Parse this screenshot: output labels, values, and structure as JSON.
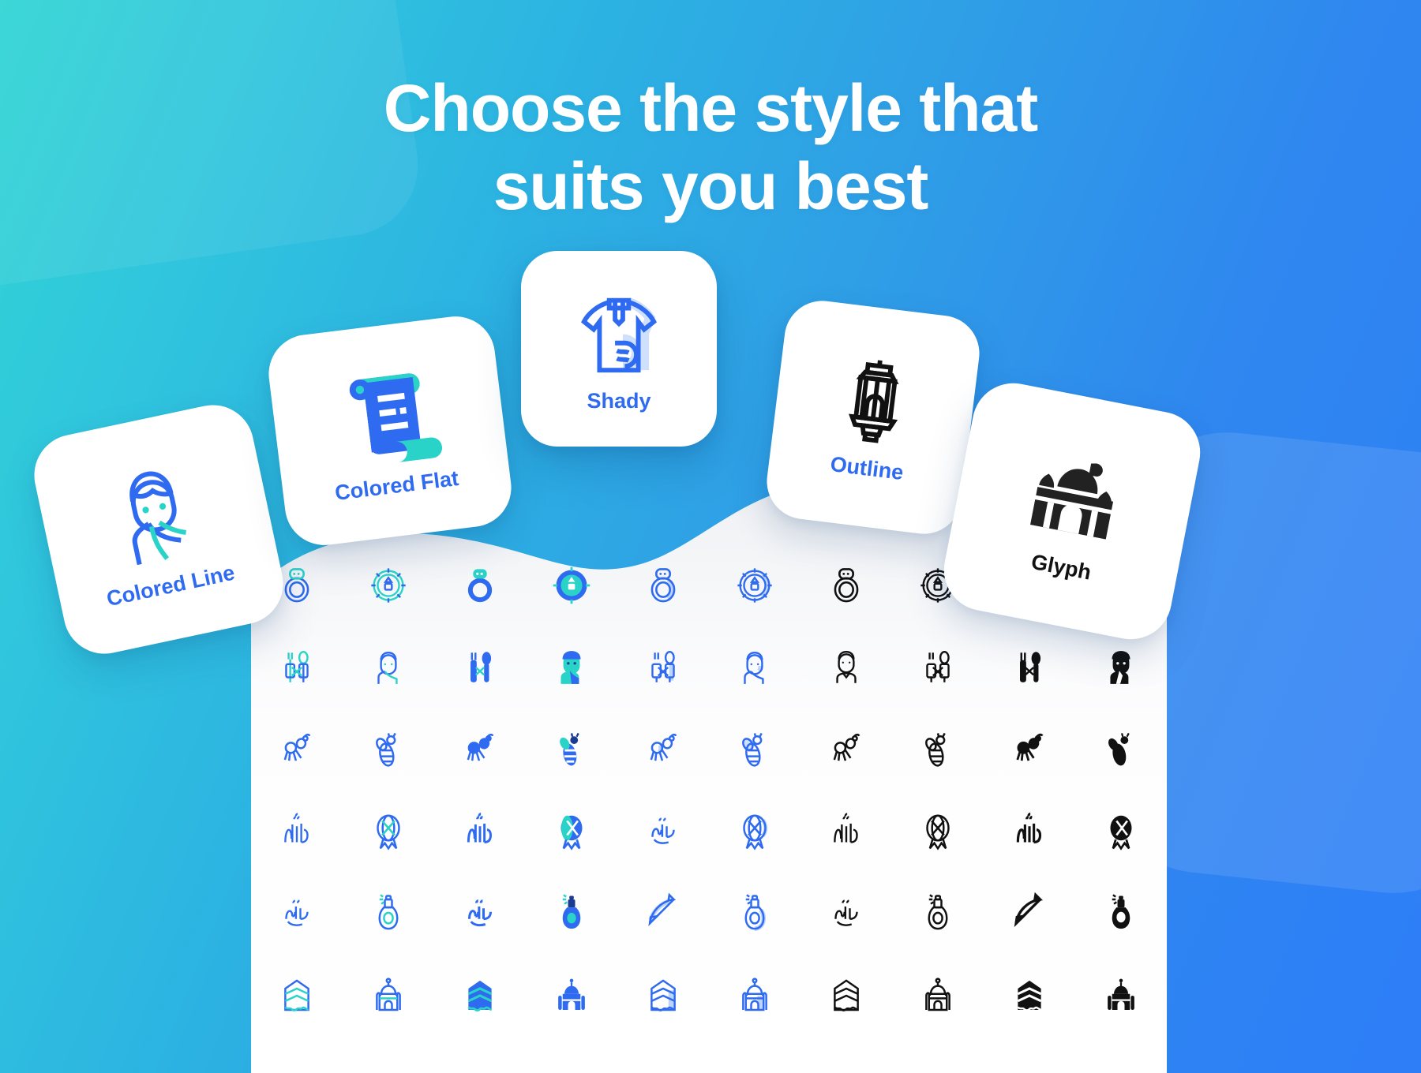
{
  "background": {
    "gradient_from": "#2fd4d4",
    "gradient_to": "#2e7ef8",
    "accent_blue": "#2f6bf0",
    "teal": "#2ad3c8",
    "black": "#111111"
  },
  "headline": {
    "line1": "Choose the style that",
    "line2": "suits you best",
    "color": "#ffffff"
  },
  "style_cards": [
    {
      "id": "colored-line",
      "label": "Colored Line",
      "icon": "muslim-man-colored-line-icon",
      "label_color": "#2f6bf0",
      "rotation_deg": -12
    },
    {
      "id": "colored-flat",
      "label": "Colored Flat",
      "icon": "scroll-colored-flat-icon",
      "label_color": "#2f6bf0",
      "rotation_deg": -7
    },
    {
      "id": "shady",
      "label": "Shady",
      "icon": "thobe-shady-icon",
      "label_color": "#2f6bf0",
      "rotation_deg": 0
    },
    {
      "id": "outline",
      "label": "Outline",
      "icon": "lantern-outline-icon",
      "label_color": "#2f6bf0",
      "rotation_deg": 7
    },
    {
      "id": "glyph",
      "label": "Glyph",
      "icon": "mosque-glyph-icon",
      "label_color": "#111111",
      "rotation_deg": 11
    }
  ],
  "icon_grid": {
    "columns": 10,
    "rows": 6,
    "column_styles": [
      "colored-line",
      "colored-line",
      "colored-flat",
      "colored-flat",
      "shady",
      "shady",
      "outline",
      "outline",
      "glyph",
      "glyph"
    ],
    "row_subjects": [
      [
        "ring-icon",
        "compass-icon"
      ],
      [
        "cutlery-icon",
        "muslim-man-icon"
      ],
      [
        "ant-icon",
        "bee-icon"
      ],
      [
        "allah-calligraphy-icon",
        "daf-drum-icon"
      ],
      [
        "muhammad-calligraphy-icon",
        "perfume-bottle-icon"
      ],
      [
        "kaaba-icon",
        "mosque-icon"
      ]
    ],
    "shady_overrides": {
      "row4_col5": "daf-drum-icon",
      "row5_col5": "bow-and-arrow-icon",
      "row3_col5": "bee-icon"
    }
  }
}
